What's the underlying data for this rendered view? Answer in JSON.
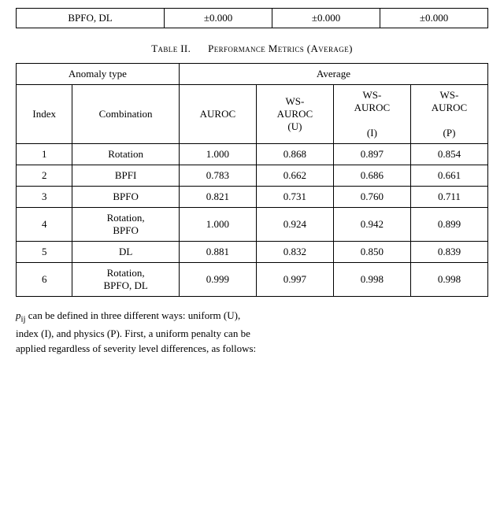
{
  "top_table": {
    "cells": [
      [
        "BPFO, DL",
        "±0.000",
        "±0.000",
        "±0.000"
      ]
    ]
  },
  "section_title": "Table II.",
  "section_subtitle": "Performance Metrics (Average)",
  "table": {
    "header": {
      "anomaly_type": "Anomaly type",
      "average": "Average",
      "col_index": "Index",
      "col_combination": "Combination",
      "col_auroc": "AUROC",
      "col_ws_auroc_u": "WS-AUROC (U)",
      "col_ws_auroc_i": "WS-AUROC (I)",
      "col_ws_auroc_p": "WS-AUROC (P)"
    },
    "rows": [
      {
        "index": "1",
        "combination": "Rotation",
        "auroc": "1.000",
        "ws_u": "0.868",
        "ws_i": "0.897",
        "ws_p": "0.854"
      },
      {
        "index": "2",
        "combination": "BPFI",
        "auroc": "0.783",
        "ws_u": "0.662",
        "ws_i": "0.686",
        "ws_p": "0.661"
      },
      {
        "index": "3",
        "combination": "BPFO",
        "auroc": "0.821",
        "ws_u": "0.731",
        "ws_i": "0.760",
        "ws_p": "0.711"
      },
      {
        "index": "4",
        "combination": "Rotation,\nBPFO",
        "auroc": "1.000",
        "ws_u": "0.924",
        "ws_i": "0.942",
        "ws_p": "0.899"
      },
      {
        "index": "5",
        "combination": "DL",
        "auroc": "0.881",
        "ws_u": "0.832",
        "ws_i": "0.850",
        "ws_p": "0.839"
      },
      {
        "index": "6",
        "combination": "Rotation,\nBPFO, DL",
        "auroc": "0.999",
        "ws_u": "0.997",
        "ws_i": "0.998",
        "ws_p": "0.998"
      }
    ]
  },
  "footer": {
    "line1": "p",
    "line1_subscript": "ij",
    "line1_rest": " can be defined in three different ways: uniform (U),",
    "line2": "index (I), and physics (P). First, a uniform penalty can be",
    "line3": "applied regardless of severity level differences, as follows:"
  }
}
